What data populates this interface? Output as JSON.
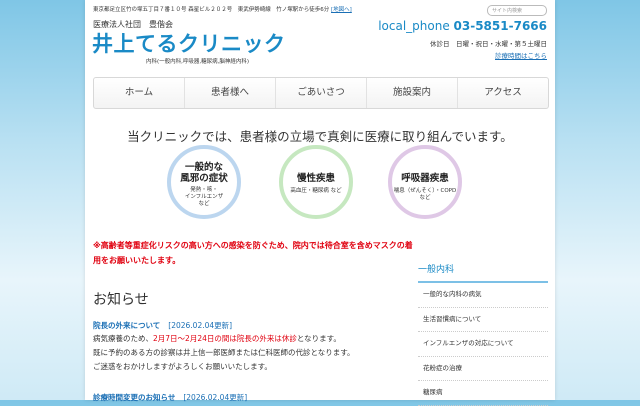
{
  "header": {
    "address": "東京都足立区竹の塚五丁目７番１０号 森星ビル２０２号　東武伊勢崎線　竹ノ塚駅から徒歩6分",
    "map_link": "[地図へ]",
    "corporation": "医療法人社団　豊偕会",
    "clinic_name": "井上てるクリニック",
    "specialties": "内科(一般内科,呼吸器,糖尿病,脳神経内科)",
    "phone_label": "local_phone",
    "phone_number": "03-5851-7666",
    "closed_days": "休診日　日曜・祝日・水曜・第５土曜日",
    "hours_link": "診療時間はこちら",
    "search_placeholder": "サイト内検索"
  },
  "nav": [
    {
      "label": "ホーム"
    },
    {
      "label": "患者様へ"
    },
    {
      "label": "ごあいさつ"
    },
    {
      "label": "施設案内"
    },
    {
      "label": "アクセス"
    }
  ],
  "slogan": "当クリニックでは、患者様の立場で真剣に医療に取り組んでいます。",
  "circles": [
    {
      "title_line1": "一般的な",
      "title_line2": "風邪の症状",
      "desc_line1": "発熱・咳・",
      "desc_line2": "インフルエンザ",
      "desc_line3": "など"
    },
    {
      "title_line1": "慢性疾患",
      "desc_line1": "高血圧・糖尿病 など"
    },
    {
      "title_line1": "呼吸器疾患",
      "desc_line1": "喘息（ぜんそく）・COPD など"
    }
  ],
  "warning": "※高齢者等重症化リスクの高い方への感染を防ぐため、院内では待合室を含めマスクの着用をお願いいたします。",
  "news": {
    "heading": "お知らせ",
    "items": [
      {
        "title": "院長の外来について",
        "date": "[2026.02.04更新]",
        "line1_pre": "病気療養のため、",
        "line1_red": "2月7日～2月24日の間は院長の外来は休診",
        "line1_post": "となります。",
        "line2": "既に予約のある方の診察は井上信一郎医師または仁科医師の代診となります。",
        "line3": "ご迷惑をおかけしますがよろしくお願いいたします。"
      },
      {
        "title": "診療時間変更のお知らせ",
        "date": "[2026.02.04更新]"
      }
    ]
  },
  "sidebar": {
    "heading": "一般内科",
    "items": [
      {
        "label": "一般的な内科の病気"
      },
      {
        "label": "生活習慣病について"
      },
      {
        "label": "インフルエンザの対応について"
      },
      {
        "label": "花粉症の治療"
      },
      {
        "label": "糖尿病"
      }
    ]
  },
  "colors": {
    "accent": "#1a8ac6",
    "warning": "#e0000f",
    "circle1": "#bcd6ef",
    "circle2": "#c6e8c0",
    "circle3": "#dfc8e6"
  }
}
